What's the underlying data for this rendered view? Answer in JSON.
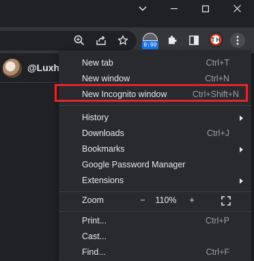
{
  "toolbar": {
    "extension_badge_time": "0:00",
    "avatar_initials": "T H"
  },
  "page": {
    "username": "@Luxh"
  },
  "menu": {
    "new_tab": {
      "label": "New tab",
      "shortcut": "Ctrl+T"
    },
    "new_window": {
      "label": "New window",
      "shortcut": "Ctrl+N"
    },
    "new_incognito": {
      "label": "New Incognito window",
      "shortcut": "Ctrl+Shift+N"
    },
    "history": {
      "label": "History"
    },
    "downloads": {
      "label": "Downloads",
      "shortcut": "Ctrl+J"
    },
    "bookmarks": {
      "label": "Bookmarks"
    },
    "password_manager": {
      "label": "Google Password Manager"
    },
    "extensions": {
      "label": "Extensions"
    },
    "zoom": {
      "label": "Zoom",
      "minus": "−",
      "value": "110%",
      "plus": "+"
    },
    "print": {
      "label": "Print...",
      "shortcut": "Ctrl+P"
    },
    "cast": {
      "label": "Cast..."
    },
    "find": {
      "label": "Find...",
      "shortcut": "Ctrl+F"
    }
  },
  "colors": {
    "menu_background": "#292a2d",
    "highlight_border": "#e3262f",
    "toolbar": "#35363a"
  }
}
